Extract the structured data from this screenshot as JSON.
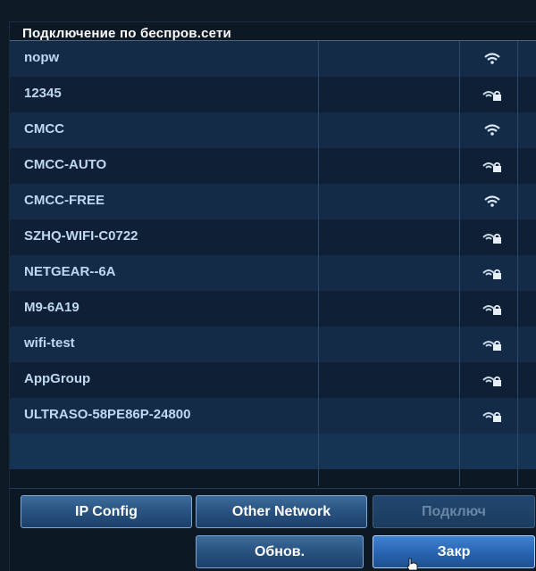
{
  "dialog": {
    "title": "Подключение по беспров.сети"
  },
  "networks": [
    {
      "name": "nopw",
      "secured": false,
      "icon": "wifi-open-icon"
    },
    {
      "name": "12345",
      "secured": true,
      "icon": "wifi-locked-icon"
    },
    {
      "name": "CMCC",
      "secured": false,
      "icon": "wifi-open-icon"
    },
    {
      "name": "CMCC-AUTO",
      "secured": true,
      "icon": "wifi-locked-icon"
    },
    {
      "name": "CMCC-FREE",
      "secured": false,
      "icon": "wifi-open-icon"
    },
    {
      "name": "SZHQ-WIFI-C0722",
      "secured": true,
      "icon": "wifi-locked-icon"
    },
    {
      "name": "NETGEAR--6A",
      "secured": true,
      "icon": "wifi-locked-icon"
    },
    {
      "name": "M9-6A19",
      "secured": true,
      "icon": "wifi-locked-icon"
    },
    {
      "name": "wifi-test",
      "secured": true,
      "icon": "wifi-locked-icon"
    },
    {
      "name": "AppGroup",
      "secured": true,
      "icon": "wifi-locked-icon"
    },
    {
      "name": "ULTRASO-58PE86P-24800",
      "secured": true,
      "icon": "wifi-locked-icon"
    }
  ],
  "buttons": {
    "ip_config": "IP Config",
    "other_network": "Other Network",
    "connect": "Подключ",
    "refresh": "Обнов.",
    "close": "Закр"
  },
  "colors": {
    "background": "#0f1a27",
    "row_dark": "#0f2036",
    "row_light": "#132b47",
    "text": "#bfd7ef",
    "button": "#2a5482",
    "button_focused": "#2a66b2"
  }
}
